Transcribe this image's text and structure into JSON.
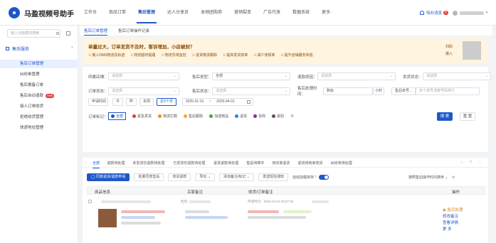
{
  "app": {
    "title": "马盈视频号助手"
  },
  "topnav": [
    "工作台",
    "商品订单",
    "售后管理",
    "达人分享员",
    "本地团购券",
    "营销裂变",
    "广告代发",
    "数据系统",
    "更多·"
  ],
  "topnav_active": 2,
  "topright": {
    "notice": "待办消息",
    "badge": "9",
    "caret": "▾"
  },
  "sidebar": {
    "search_placeholder": "输入功能模块搜索",
    "group_label": "售后服务",
    "group_caret": "⌃",
    "items": [
      {
        "label": "售后订单管理",
        "active": true
      },
      {
        "label": "纠纷单管理"
      },
      {
        "label": "售后报备订单"
      },
      {
        "label": "售后自动退款",
        "hot": "new"
      },
      {
        "label": "接入订单收货"
      },
      {
        "label": "拒绝收货管理"
      },
      {
        "label": "快递地址管理"
      }
    ]
  },
  "tabs1": [
    "售后订单管理",
    "售后订单操作记录"
  ],
  "banner": {
    "title": "单量过大，订单发货不及时，客诉增加，小店被封？",
    "pills": [
      "接入DMS物流及轨迹",
      "物流超时提醒",
      "物流异常监控",
      "退货物流跟踪",
      "提高发货效率",
      "减少违规率",
      "提升店铺服务体验"
    ],
    "pill_mark": "⊙",
    "side1": "扫码",
    "side2": "接入"
  },
  "filters": {
    "shop_label": "所属店铺：",
    "shop_ph": "请选择",
    "type_label": "售后类型：",
    "type_value": "全部",
    "reason_label": "退款原因：",
    "reason_ph": "请选择",
    "ship_label": "发货状态：",
    "ship_ph": "请选择",
    "order_label": "订单状态：",
    "order_ph": "请选择",
    "after_label": "售后状态：",
    "after_ph": "请选择",
    "time_label": "售后处理时间：",
    "time_value": "剩余",
    "hour_unit": "小时",
    "no_label": "售后单号",
    "no_ph": "多个单号请按号码排行",
    "date_label": "申请时间",
    "date_btns": [
      "今",
      "昨",
      "本周",
      "近3个月"
    ],
    "date_active": 3,
    "date_start": "2025-01-01",
    "date_to": "~",
    "date_end": "2025-04-01",
    "dropdown_mark": "⌄",
    "mark_label": "订单标记：",
    "marks": [
      {
        "label": "全部",
        "color": "#1f57c9"
      },
      {
        "label": "紧急发货",
        "color": "#e53935"
      },
      {
        "label": "物流拦截",
        "color": "#fb8c00"
      },
      {
        "label": "售后跟踪",
        "color": "#f9a825"
      },
      {
        "label": "加送赠品",
        "color": "#43a047"
      },
      {
        "label": "退货",
        "color": "#1e88e5"
      },
      {
        "label": "协商",
        "color": "#8e24aa"
      },
      {
        "label": "属别",
        "color": "#6d4c41"
      }
    ],
    "mark_more": "⚙",
    "search": "搜 索",
    "reset": "重 置"
  },
  "list_tabs": [
    "全部",
    "退款待处理",
    "未发货仅退款待处理",
    "已发货仅退款待处理",
    "退货退款待处理",
    "售后待寄中",
    "待买家退货",
    "退货待商家收货",
    "纠纷单待处理"
  ],
  "list_tab_active": 0,
  "list_nav": {
    "prev": "‹",
    "next": "›",
    "help": "?",
    "more": "⋮"
  },
  "toolbar": {
    "batch": "◯ 同意退货/退款申请",
    "btns": [
      "批量同意售后",
      "收货退款",
      "导出 ⌄",
      "添加备注/标记 ⌄",
      "发送短信通知"
    ],
    "auto_label": "自动加载库存",
    "auto_help": "?",
    "sort": "按照售后操作时间排序 ⌄",
    "settings": "⚙"
  },
  "thead": [
    "商品信息",
    "买家备注",
    "收货/订单备注",
    "操作"
  ],
  "row": {
    "hdr_text": "申请时间：2025-04-01 09:07:08",
    "hdr_mid": "售后：",
    "ops": {
      "status": "◉ 售后处理",
      "list": [
        "修改备注",
        "查看详情",
        "更 多"
      ]
    }
  }
}
